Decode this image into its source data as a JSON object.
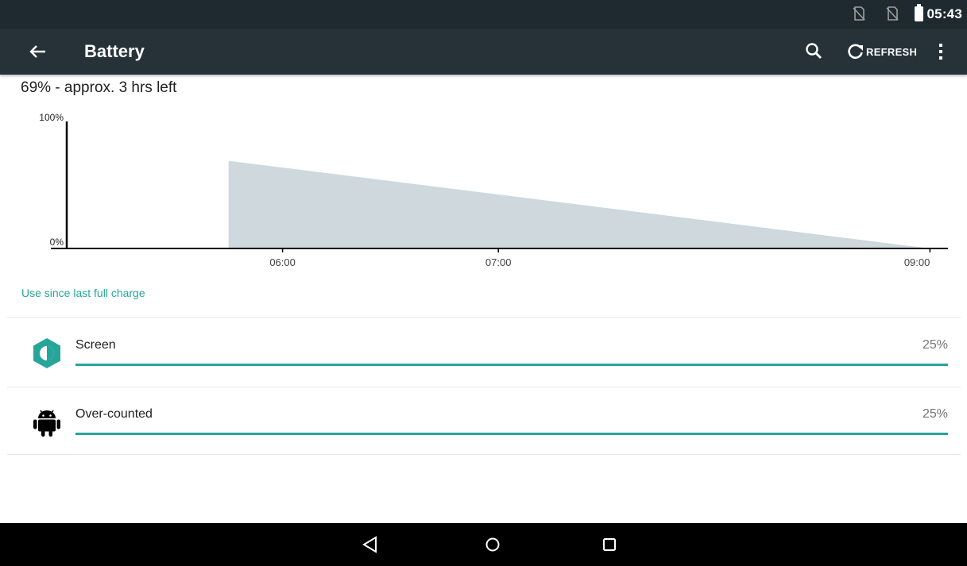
{
  "status_bar": {
    "time": "05:43",
    "icons": [
      "no-sim-icon",
      "no-sim-icon",
      "battery-icon"
    ]
  },
  "app_bar": {
    "title": "Battery",
    "refresh_label": "REFRESH",
    "icons": [
      "back-arrow-icon",
      "search-icon",
      "refresh-icon",
      "more-vert-icon"
    ]
  },
  "summary": "69% - approx. 3 hrs left",
  "chart_data": {
    "type": "area",
    "ylabels": [
      "100%",
      "0%"
    ],
    "ylim": [
      0,
      100
    ],
    "xticks": [
      "06:00",
      "07:00",
      "09:00"
    ],
    "x": [
      "05:45",
      "09:00"
    ],
    "values": [
      69,
      0
    ],
    "fill_color": "#cfd8dc",
    "axis_color": "#000000"
  },
  "since_link": "Use since last full charge",
  "usage": [
    {
      "name": "Screen",
      "percent": "25%",
      "value": 25,
      "icon": "brightness-icon"
    },
    {
      "name": "Over-counted",
      "percent": "25%",
      "value": 25,
      "icon": "android-icon"
    }
  ],
  "accent_color": "#26a69a",
  "nav_bar": {
    "icons": [
      "back-triangle-icon",
      "home-circle-icon",
      "recents-square-icon"
    ]
  }
}
